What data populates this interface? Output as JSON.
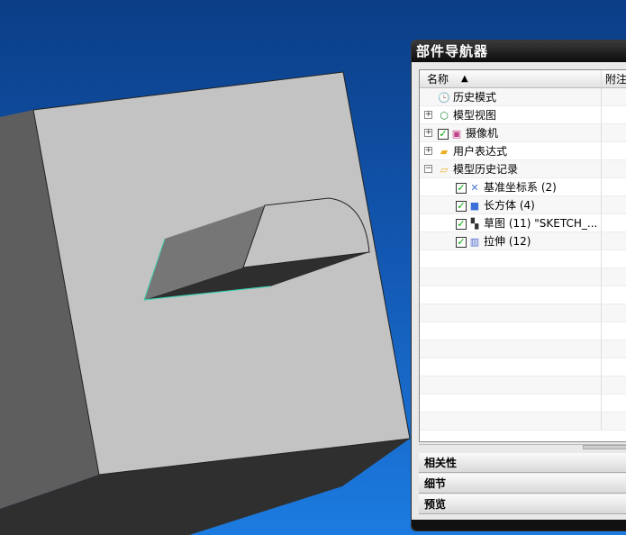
{
  "panel": {
    "title": "部件导航器",
    "columns": {
      "name": "名称",
      "note": "附注"
    },
    "rows": [
      {
        "label": "历史模式",
        "icon": "clock-icon",
        "expander": "none",
        "indent": 0
      },
      {
        "label": "模型视图",
        "icon": "model-view-icon",
        "expander": "plus",
        "indent": 0
      },
      {
        "label": "摄像机",
        "icon": "camera-icon",
        "expander": "plus",
        "indent": 0,
        "checked": true
      },
      {
        "label": "用户表达式",
        "icon": "folder-icon",
        "expander": "plus",
        "indent": 0
      },
      {
        "label": "模型历史记录",
        "icon": "folder-open-icon",
        "expander": "minus",
        "indent": 0
      },
      {
        "label": "基准坐标系 (2)",
        "icon": "datum-csys-icon",
        "indent": 1,
        "checked": true
      },
      {
        "label": "长方体 (4)",
        "icon": "block-icon",
        "indent": 1,
        "checked": true
      },
      {
        "label": "草图 (11) \"SKETCH_...",
        "icon": "sketch-icon",
        "indent": 1,
        "checked": true
      },
      {
        "label": "拉伸 (12)",
        "icon": "extrude-icon",
        "indent": 1,
        "checked": true
      }
    ],
    "sections": [
      "相关性",
      "细节",
      "预览"
    ]
  },
  "colors": {
    "background_top": "#0b3e86",
    "background_bottom": "#1c7be0",
    "edge_highlight": "#3fd0b0"
  }
}
